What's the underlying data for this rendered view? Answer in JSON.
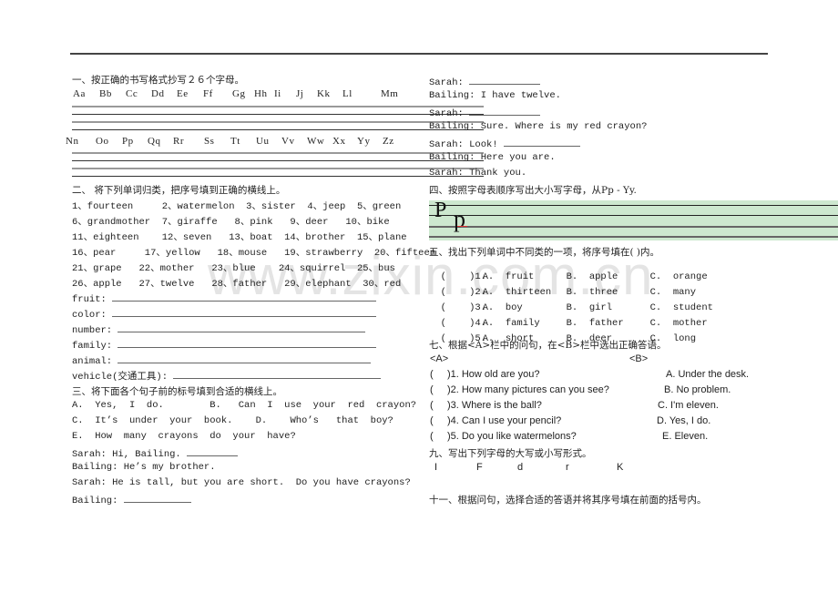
{
  "section1": {
    "title": "一、按正确的书写格式抄写２６个字母。",
    "row1": [
      "Aa",
      "Bb",
      "Cc",
      "Dd",
      "Ee",
      "Ff",
      "Gg",
      "Hh",
      "Ii",
      "Jj",
      "Kk",
      "Ll",
      "Mm"
    ],
    "row2": [
      "Nn",
      "Oo",
      "Pp",
      "Qq",
      "Rr",
      "Ss",
      "Tt",
      "Uu",
      "Vv",
      "Ww",
      "Xx",
      "Yy",
      "Zz"
    ]
  },
  "section2": {
    "title": "二、  将下列单词归类，把序号填到正确的横线上。",
    "word_rows": [
      "1、fourteen     2、watermelon  3、sister  4、jeep  5、green",
      "6、grandmother  7、giraffe   8、pink   9、deer   10、bike",
      "11、eighteen    12、seven   13、boat  14、brother  15、plane",
      "16、pear     17、yellow   18、mouse   19、strawberry  20、fifteen",
      "21、grape   22、mother   23、blue    24、squirrel  25、bus",
      "26、apple   27、twelve   28、father   29、elephant  30、red"
    ],
    "categories": [
      "fruit:",
      "color:",
      "number:",
      "family:",
      "animal:",
      "vehicle(交通工具):"
    ]
  },
  "section3": {
    "title": "三、将下面各个句子前的标号填到合适的横线上。",
    "options": [
      "A.  Yes,  I  do.        B.   Can  I  use  your  red  crayon?",
      "C.  It’s  under  your  book.    D.    Who’s   that  boy?",
      "E.  How  many  crayons  do  your  have?"
    ],
    "dialogue_left": [
      {
        "text": "Sarah: Hi, Bailing. ",
        "blank": true
      },
      {
        "text": "Bailing: He’s my brother.",
        "blank": false
      },
      {
        "text": "Sarah: He is tall, but you are short.  Do you have crayons?",
        "blank": false
      },
      {
        "text": "Bailing: ",
        "blank": true
      }
    ],
    "dialogue_right": [
      {
        "text": "Sarah: ",
        "blank": true
      },
      {
        "text": "Bailing: I have twelve.",
        "blank": false
      },
      {
        "text": "Sarah: ",
        "blank": true
      },
      {
        "text": "Bailing: Sure. Where is my red crayon?",
        "blank": false
      },
      {
        "text": "Sarah: Look! ",
        "blank": true
      },
      {
        "text": "Bailing: Here you are.",
        "blank": false
      },
      {
        "text": "Sarah: Thank you.",
        "blank": false
      }
    ]
  },
  "section4": {
    "title": "四、按照字母表顺序写出大小写字母，从Pp - Yy.",
    "sample_upper": "P",
    "sample_lower": "p",
    "box_color": "#cde8cf"
  },
  "section5": {
    "title": "五、找出下列单词中不同类的一项，将序号填在(    )内。",
    "items": [
      {
        "num": "(    )1.",
        "a": "A.  fruit",
        "b": "B.  apple",
        "c": "C.  orange"
      },
      {
        "num": "(    )2.",
        "a": "A.  thirteen",
        "b": "B.  three",
        "c": "C.  many"
      },
      {
        "num": "(    )3.",
        "a": "A.  boy",
        "b": "B.  girl",
        "c": "C.  student"
      },
      {
        "num": "(    )4.",
        "a": "A.  family",
        "b": "B.  father",
        "c": "C.  mother"
      },
      {
        "num": "(    )5.",
        "a": "A.  short",
        "b": "B.  deer",
        "c": "C.  long"
      }
    ]
  },
  "section7": {
    "title": "七、根据<A>栏中的问句，在<B>栏中选出正确答语。",
    "col_a_header": "<A>",
    "col_b_header": "<B>",
    "questions": [
      {
        "q": "(     )1. How old are you?",
        "a": "A. Under the desk."
      },
      {
        "q": "(     )2. How many pictures can you see?",
        "a": "B. No problem."
      },
      {
        "q": "(     )3. Where is the ball?",
        "a": "C. I'm eleven."
      },
      {
        "q": "(     )4. Can I use your pencil?",
        "a": "D. Yes, I do."
      },
      {
        "q": "(     )5. Do you like watermelons?",
        "a": "E. Eleven."
      }
    ]
  },
  "section9": {
    "title": "九、写出下列字母的大写或小写形式。",
    "letters": [
      "I",
      "F",
      "d",
      "r",
      "K"
    ]
  },
  "section11": {
    "title": "十一、根据问句，选择合适的答语并将其序号填在前面的括号内。"
  },
  "watermark": "www.zixin.com.cn"
}
